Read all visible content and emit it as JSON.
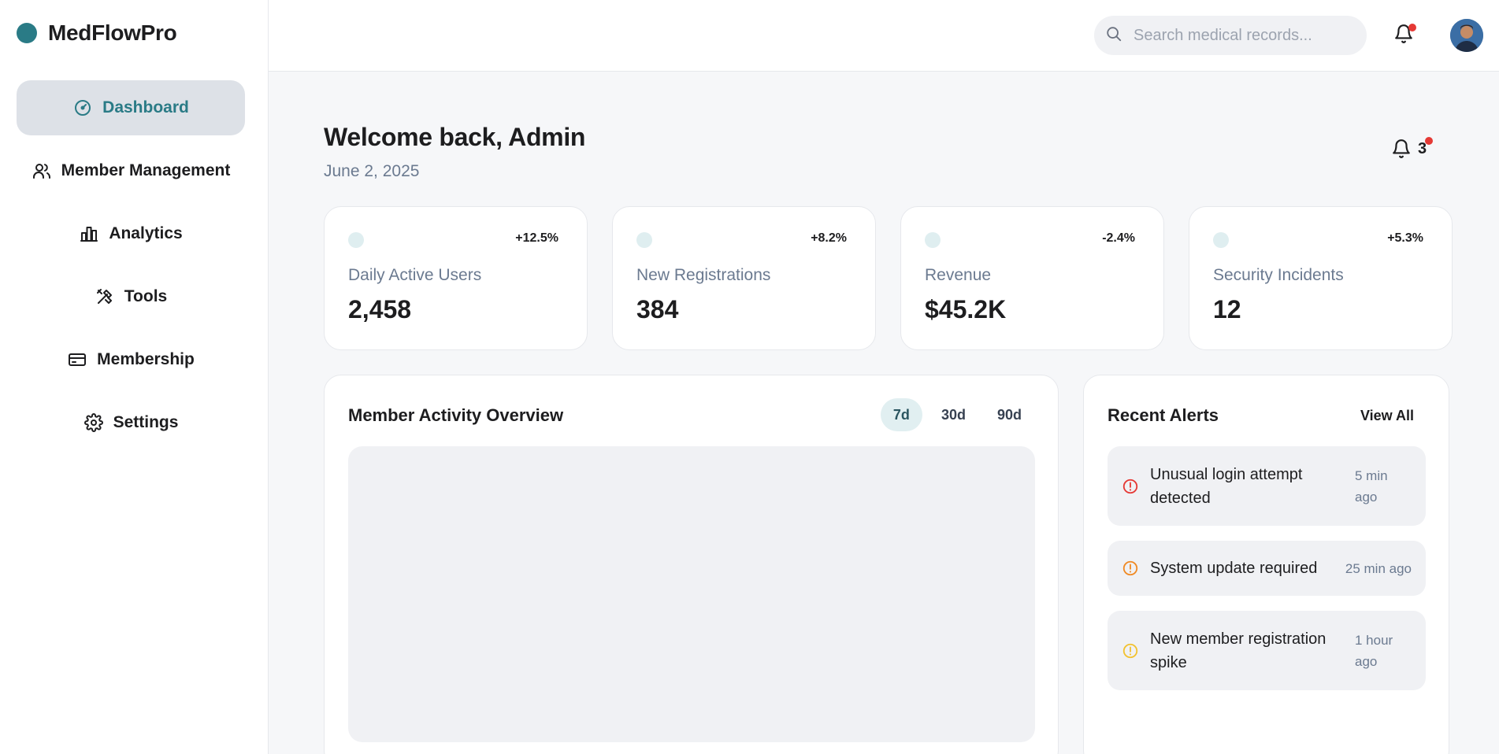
{
  "app": {
    "name": "MedFlowPro",
    "accent": "#2a7b86"
  },
  "sidebar": {
    "items": [
      {
        "label": "Dashboard",
        "icon": "gauge-icon",
        "active": true
      },
      {
        "label": "Member Management",
        "icon": "users-icon"
      },
      {
        "label": "Analytics",
        "icon": "bar-chart-icon"
      },
      {
        "label": "Tools",
        "icon": "tools-icon"
      },
      {
        "label": "Membership",
        "icon": "card-icon"
      },
      {
        "label": "Settings",
        "icon": "gear-icon"
      }
    ]
  },
  "header": {
    "search_placeholder": "Search medical records...",
    "has_notification": true
  },
  "main": {
    "welcome": "Welcome back, Admin",
    "date": "June 2, 2025",
    "notification_count": "3",
    "stats": [
      {
        "label": "Daily Active Users",
        "value": "2,458",
        "change": "+12.5%"
      },
      {
        "label": "New Registrations",
        "value": "384",
        "change": "+8.2%"
      },
      {
        "label": "Revenue",
        "value": "$45.2K",
        "change": "-2.4%"
      },
      {
        "label": "Security Incidents",
        "value": "12",
        "change": "+5.3%"
      }
    ],
    "activity": {
      "title": "Member Activity Overview",
      "ranges": [
        "7d",
        "30d",
        "90d"
      ],
      "selected_range": "7d"
    },
    "alerts": {
      "title": "Recent Alerts",
      "view_all": "View All",
      "items": [
        {
          "text": "Unusual login attempt detected",
          "time": "5 min ago",
          "color": "#e53935"
        },
        {
          "text": "System update required",
          "time": "25 min ago",
          "color": "#f08a24"
        },
        {
          "text": "New member registration spike",
          "time": "1 hour ago",
          "color": "#f2c230"
        }
      ]
    }
  }
}
